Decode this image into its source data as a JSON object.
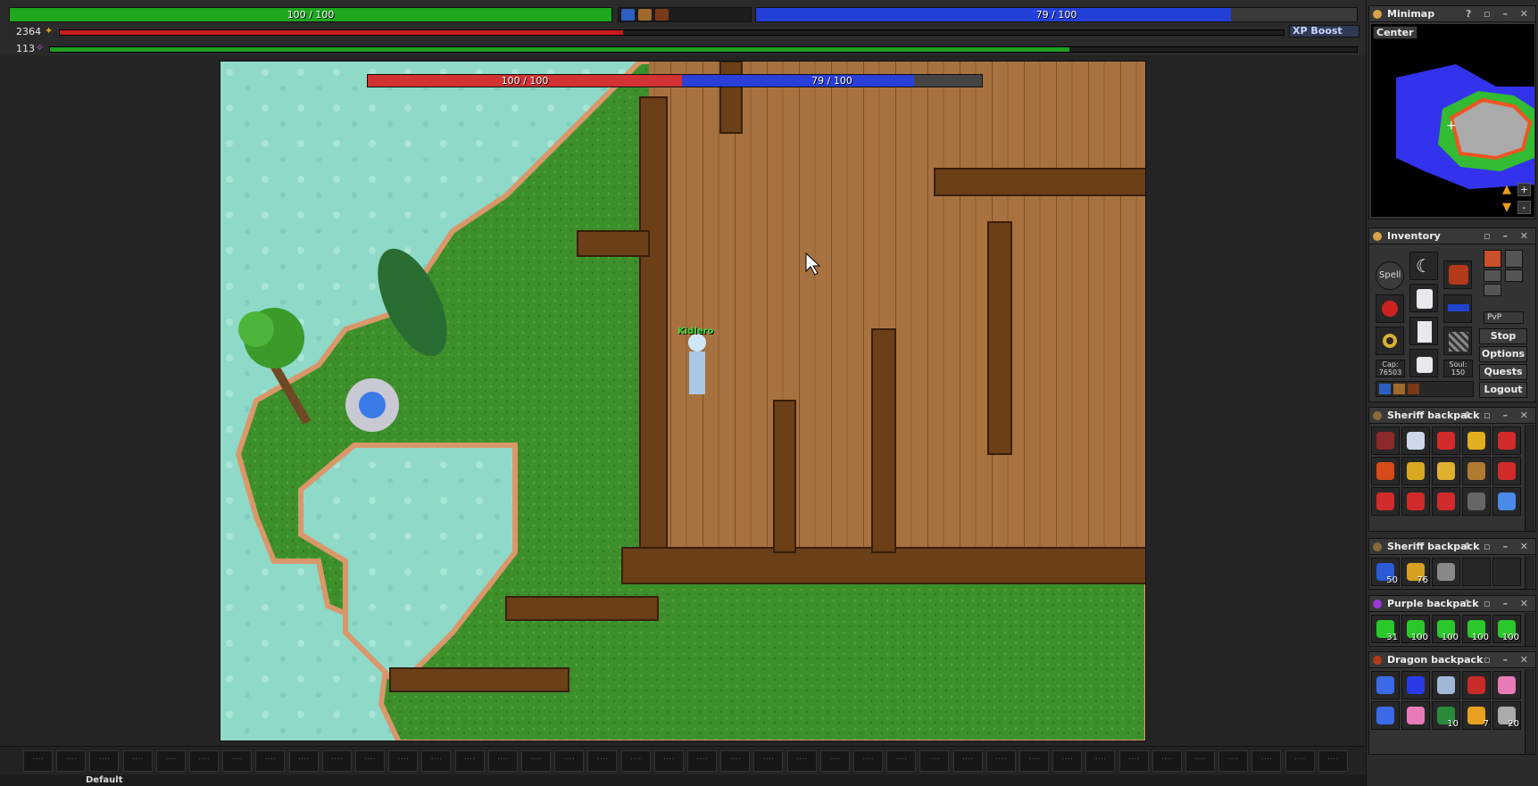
{
  "status": {
    "health_text": "100 / 100",
    "mana_text": "79 / 100",
    "health_fraction": 1.0,
    "mana_fraction": 0.79,
    "experience": "2364",
    "experience_progress": 0.46,
    "level": "113",
    "level_progress": 0.78,
    "xp_boost_label": "XP Boost",
    "colors": {
      "health": "#1ea81e",
      "mana": "#2240d8",
      "xp": "#c81c1c",
      "level": "#1fa01f"
    }
  },
  "game": {
    "player_name": "Kidlero",
    "overhead_health_text": "100 / 100",
    "overhead_mana_text": "79 / 100"
  },
  "minimap": {
    "title": "Minimap",
    "center_label": "Center",
    "help_label": "?",
    "zoom_in": "+",
    "zoom_out": "-"
  },
  "inventory": {
    "title": "Inventory",
    "spell_label": "Spell",
    "cap_label": "Cap:",
    "cap_value": "76503",
    "soul_label": "Soul:",
    "soul_value": "150",
    "pvp_label": "PvP",
    "buttons": {
      "stop": "Stop",
      "options": "Options",
      "quests": "Quests",
      "logout": "Logout"
    }
  },
  "containers": [
    {
      "title": "Sheriff backpack",
      "items": [
        {
          "icon": "guitar-icon",
          "count": ""
        },
        {
          "icon": "scroll-icon",
          "count": ""
        },
        {
          "icon": "spellbook-red-icon",
          "count": ""
        },
        {
          "icon": "gold-ingot-icon",
          "count": ""
        },
        {
          "icon": "spellbook-red-icon",
          "count": ""
        },
        {
          "icon": "boxing-glove-icon",
          "count": ""
        },
        {
          "icon": "golden-claw-icon",
          "count": ""
        },
        {
          "icon": "golden-armor-icon",
          "count": ""
        },
        {
          "icon": "sandals-icon",
          "count": ""
        },
        {
          "icon": "spellbook-red-icon",
          "count": ""
        },
        {
          "icon": "spellbook-red-icon",
          "count": ""
        },
        {
          "icon": "spellbook-red-icon",
          "count": ""
        },
        {
          "icon": "spellbook-red-icon",
          "count": ""
        },
        {
          "icon": "helmet-icon",
          "count": ""
        },
        {
          "icon": "wand-icon",
          "count": ""
        }
      ]
    },
    {
      "title": "Sheriff backpack",
      "items": [
        {
          "icon": "blue-rune-icon",
          "count": "50"
        },
        {
          "icon": "gold-rune-icon",
          "count": "76"
        },
        {
          "icon": "star-icon",
          "count": ""
        }
      ]
    },
    {
      "title": "Purple backpack",
      "items": [
        {
          "icon": "green-gem-icon",
          "count": "31"
        },
        {
          "icon": "green-gem-icon",
          "count": "100"
        },
        {
          "icon": "green-gem-icon",
          "count": "100"
        },
        {
          "icon": "green-gem-icon",
          "count": "100"
        },
        {
          "icon": "green-gem-icon",
          "count": "100"
        }
      ]
    },
    {
      "title": "Dragon backpack",
      "items": [
        {
          "icon": "mana-potion-icon",
          "count": ""
        },
        {
          "icon": "blue-orb-icon",
          "count": ""
        },
        {
          "icon": "potion-icon",
          "count": ""
        },
        {
          "icon": "red-wing-icon",
          "count": ""
        },
        {
          "icon": "pink-potion-icon",
          "count": ""
        },
        {
          "icon": "mana-potion-icon",
          "count": ""
        },
        {
          "icon": "pink-potion-icon",
          "count": ""
        },
        {
          "icon": "green-rune-icon",
          "count": "10"
        },
        {
          "icon": "sun-orb-icon",
          "count": "7"
        },
        {
          "icon": "stairs-icon",
          "count": "20"
        }
      ]
    }
  ],
  "bottom_tabs": [
    "Default"
  ]
}
